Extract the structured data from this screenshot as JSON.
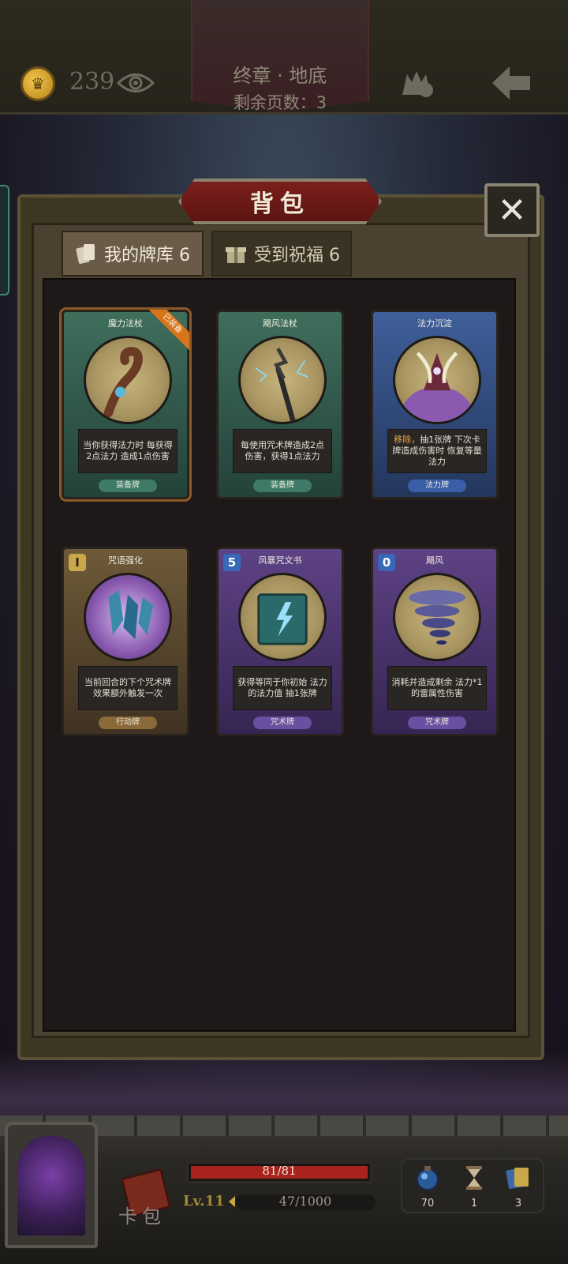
{
  "header": {
    "coins": "239",
    "chapter_title": "终章 · 地底",
    "pages_left": "剩余页数：3"
  },
  "panel": {
    "title": "背包",
    "close_icon": "close-icon",
    "tabs": [
      {
        "label": "我的牌库 6",
        "icon": "cards-icon",
        "active": true
      },
      {
        "label": "受到祝福 6",
        "icon": "gift-icon",
        "active": false
      }
    ]
  },
  "cards": [
    {
      "name": "魔力法杖",
      "desc": "当你获得法力时 每获得2点法力 造成1点伤害",
      "type": "装备牌",
      "badge": "已装备",
      "color": "green",
      "cost": ""
    },
    {
      "name": "飓风法杖",
      "desc": "每使用咒术牌造成2点 伤害，获得1点法力",
      "type": "装备牌",
      "badge": "",
      "color": "green",
      "cost": ""
    },
    {
      "name": "法力沉淀",
      "desc_highlight": "移除，",
      "desc": "抽1张牌 下次卡牌造成伤害时 恢复等量法力",
      "type": "法力牌",
      "badge": "",
      "color": "blue",
      "cost": ""
    },
    {
      "name": "咒语强化",
      "desc": "当前回合的下个咒术牌 效果额外触发一次",
      "type": "行动牌",
      "badge": "",
      "color": "brown",
      "cost": "I"
    },
    {
      "name": "风暴咒文书",
      "desc": "获得等同于你初始 法力的法力值 抽1张牌",
      "type": "咒术牌",
      "badge": "",
      "color": "purple",
      "cost": "5"
    },
    {
      "name": "飓风",
      "desc": "消耗并造成剩余 法力*1的雷属性伤害",
      "type": "咒术牌",
      "badge": "",
      "color": "purple",
      "cost": "0"
    }
  ],
  "hud": {
    "hp": "81/81",
    "hp_fraction": 1.0,
    "level": "Lv.11",
    "xp": "47/1000",
    "deck_label": "卡包",
    "potions": "70",
    "hourglass": "1",
    "card_count": "3"
  },
  "colors": {
    "hp": "#a8231e",
    "accent_gold": "#a08838",
    "banner_red": "#7a1f1c"
  }
}
